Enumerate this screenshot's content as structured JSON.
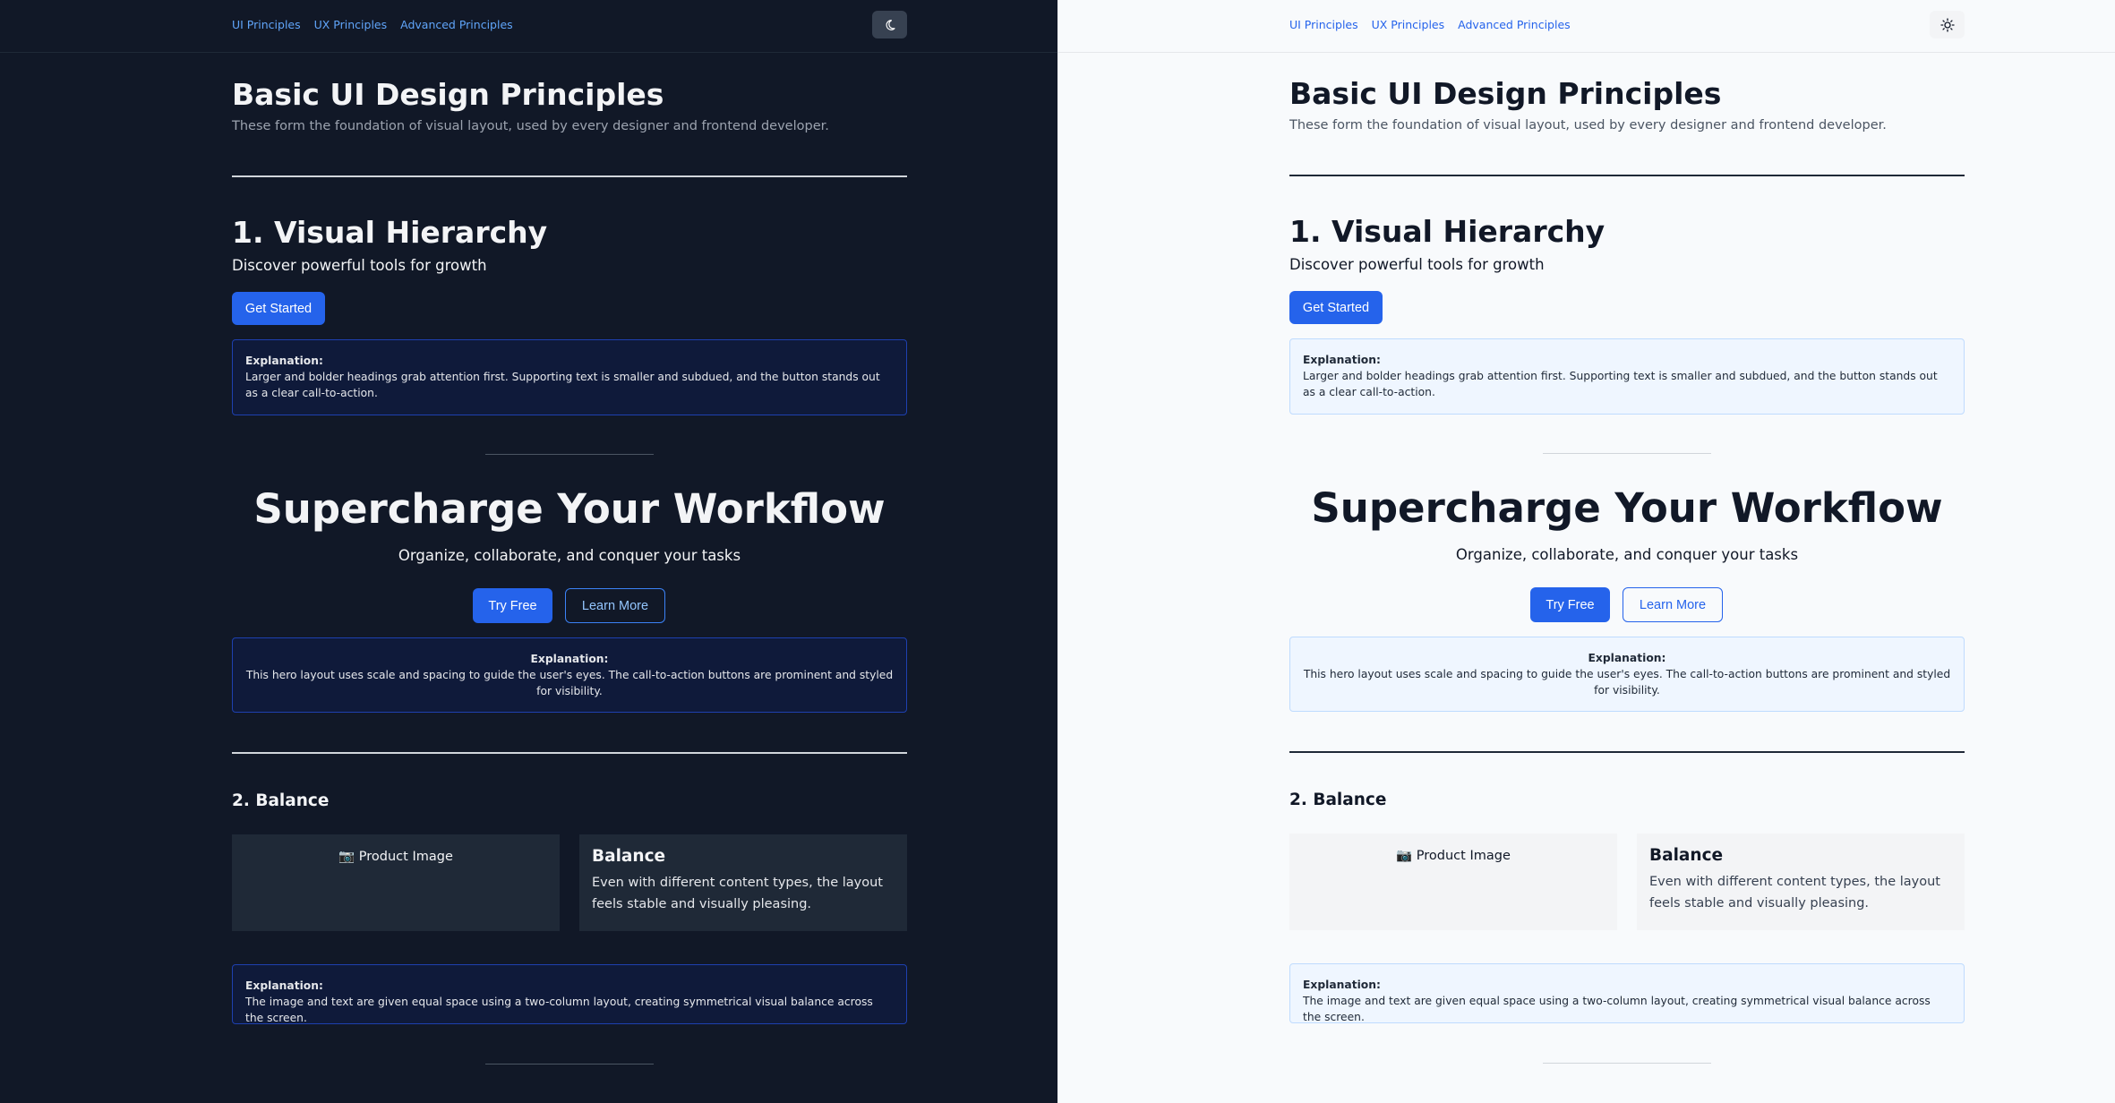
{
  "nav": {
    "ui": "UI Principles",
    "ux": "UX Principles",
    "advanced": "Advanced Principles"
  },
  "page": {
    "title": "Basic UI Design Principles",
    "subtitle": "These form the foundation of visual layout, used by every designer and frontend developer."
  },
  "hierarchy": {
    "heading": "1. Visual Hierarchy",
    "tagline": "Discover powerful tools for growth",
    "button": "Get Started",
    "explain_label": "Explanation:",
    "explain_text": "Larger and bolder headings grab attention first. Supporting text is smaller and subdued, and the button stands out as a clear call-to-action."
  },
  "hero": {
    "title": "Supercharge Your Workflow",
    "subtitle": "Organize, collaborate, and conquer your tasks",
    "primary": "Try Free",
    "secondary": "Learn More",
    "explain_label": "Explanation:",
    "explain_text": "This hero layout uses scale and spacing to guide the user's eyes. The call-to-action buttons are prominent and styled for visibility."
  },
  "balance": {
    "heading": "2. Balance",
    "image_label": "📷 Product Image",
    "card_title": "Balance",
    "card_text": "Even with different content types, the layout feels stable and visually pleasing.",
    "explain_label": "Explanation:",
    "explain_text": "The image and text are given equal space using a two-column layout, creating symmetrical visual balance across the screen."
  },
  "theme": {
    "dark_icon": "moon-icon",
    "light_icon": "sun-icon"
  },
  "colors": {
    "dark_bg": "#111827",
    "light_bg": "#f8fafc",
    "accent": "#2563eb"
  }
}
